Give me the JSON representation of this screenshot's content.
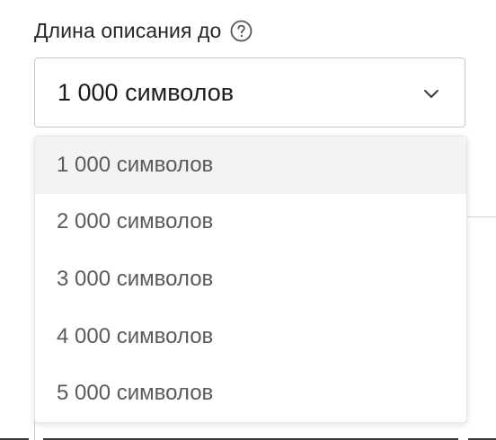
{
  "field": {
    "label": "Длина описания до",
    "help_icon": "question-circle-icon",
    "selected_value": "1 000 символов",
    "chevron_icon": "chevron-down-icon"
  },
  "dropdown": {
    "options": [
      {
        "label": "1 000 символов",
        "selected": true
      },
      {
        "label": "2 000 символов",
        "selected": false
      },
      {
        "label": "3 000 символов",
        "selected": false
      },
      {
        "label": "4 000 символов",
        "selected": false
      },
      {
        "label": "5 000 символов",
        "selected": false
      }
    ]
  },
  "colors": {
    "label_text": "#262626",
    "option_text": "#5a5a5a",
    "selected_option_bg": "#f3f3f3",
    "border": "#c8c8c8"
  }
}
